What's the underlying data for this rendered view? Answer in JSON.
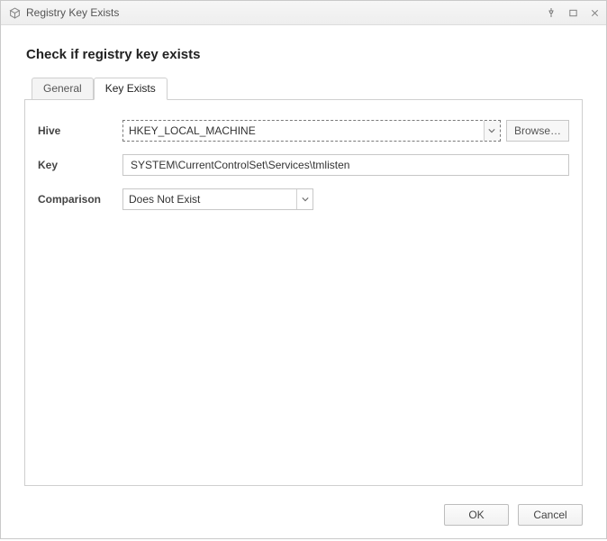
{
  "window": {
    "title": "Registry Key Exists"
  },
  "heading": "Check if registry key exists",
  "tabs": {
    "general": "General",
    "keyExists": "Key Exists"
  },
  "form": {
    "hive": {
      "label": "Hive",
      "value": "HKEY_LOCAL_MACHINE",
      "browse": "Browse…"
    },
    "key": {
      "label": "Key",
      "value": "SYSTEM\\CurrentControlSet\\Services\\tmlisten"
    },
    "comparison": {
      "label": "Comparison",
      "value": "Does Not Exist"
    }
  },
  "buttons": {
    "ok": "OK",
    "cancel": "Cancel"
  }
}
